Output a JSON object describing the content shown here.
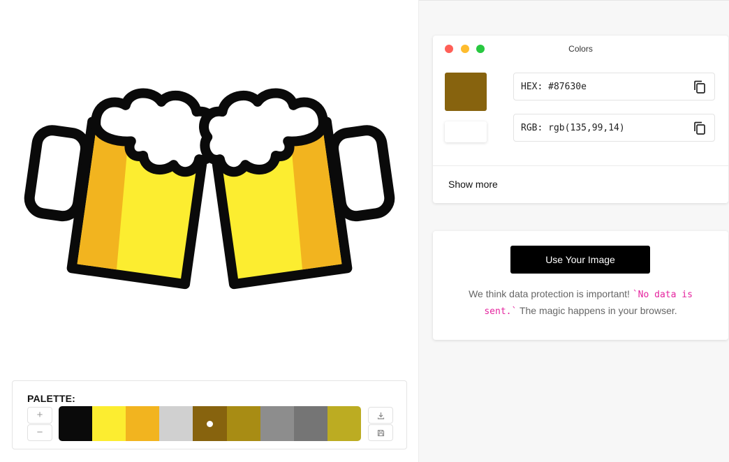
{
  "palette": {
    "title": "PALETTE:",
    "increase_label": "+",
    "decrease_label": "−",
    "swatches": [
      {
        "color": "#0a0a0a",
        "selected": false
      },
      {
        "color": "#fced30",
        "selected": false
      },
      {
        "color": "#f2b41f",
        "selected": false
      },
      {
        "color": "#d0d0d0",
        "selected": false
      },
      {
        "color": "#87630e",
        "selected": true
      },
      {
        "color": "#a88c14",
        "selected": false
      },
      {
        "color": "#8d8d8d",
        "selected": false
      },
      {
        "color": "#757575",
        "selected": false
      },
      {
        "color": "#bcac22",
        "selected": false
      }
    ],
    "download_icon": "download-icon",
    "save_icon": "save-icon"
  },
  "colors_panel": {
    "title": "Colors",
    "window_buttons": {
      "close": "#ff5f57",
      "minimize": "#febc2e",
      "zoom": "#28c840"
    },
    "selected_color": "#87630e",
    "hex_text": "HEX: #87630e",
    "rgb_text": "RGB: rgb(135,99,14)",
    "copy_icon": "copy-icon",
    "show_more": "Show more"
  },
  "upload": {
    "button_label": "Use Your Image",
    "notice_before": "We think data protection is important! ",
    "notice_code": "`No data is sent.`",
    "notice_after": " The magic happens in your browser."
  },
  "artwork": {
    "subject": "two clinking beer mugs",
    "colors": {
      "outline": "#0a0a0a",
      "beer": "#fced30",
      "shade": "#f2b41f",
      "foam": "#ffffff"
    }
  }
}
